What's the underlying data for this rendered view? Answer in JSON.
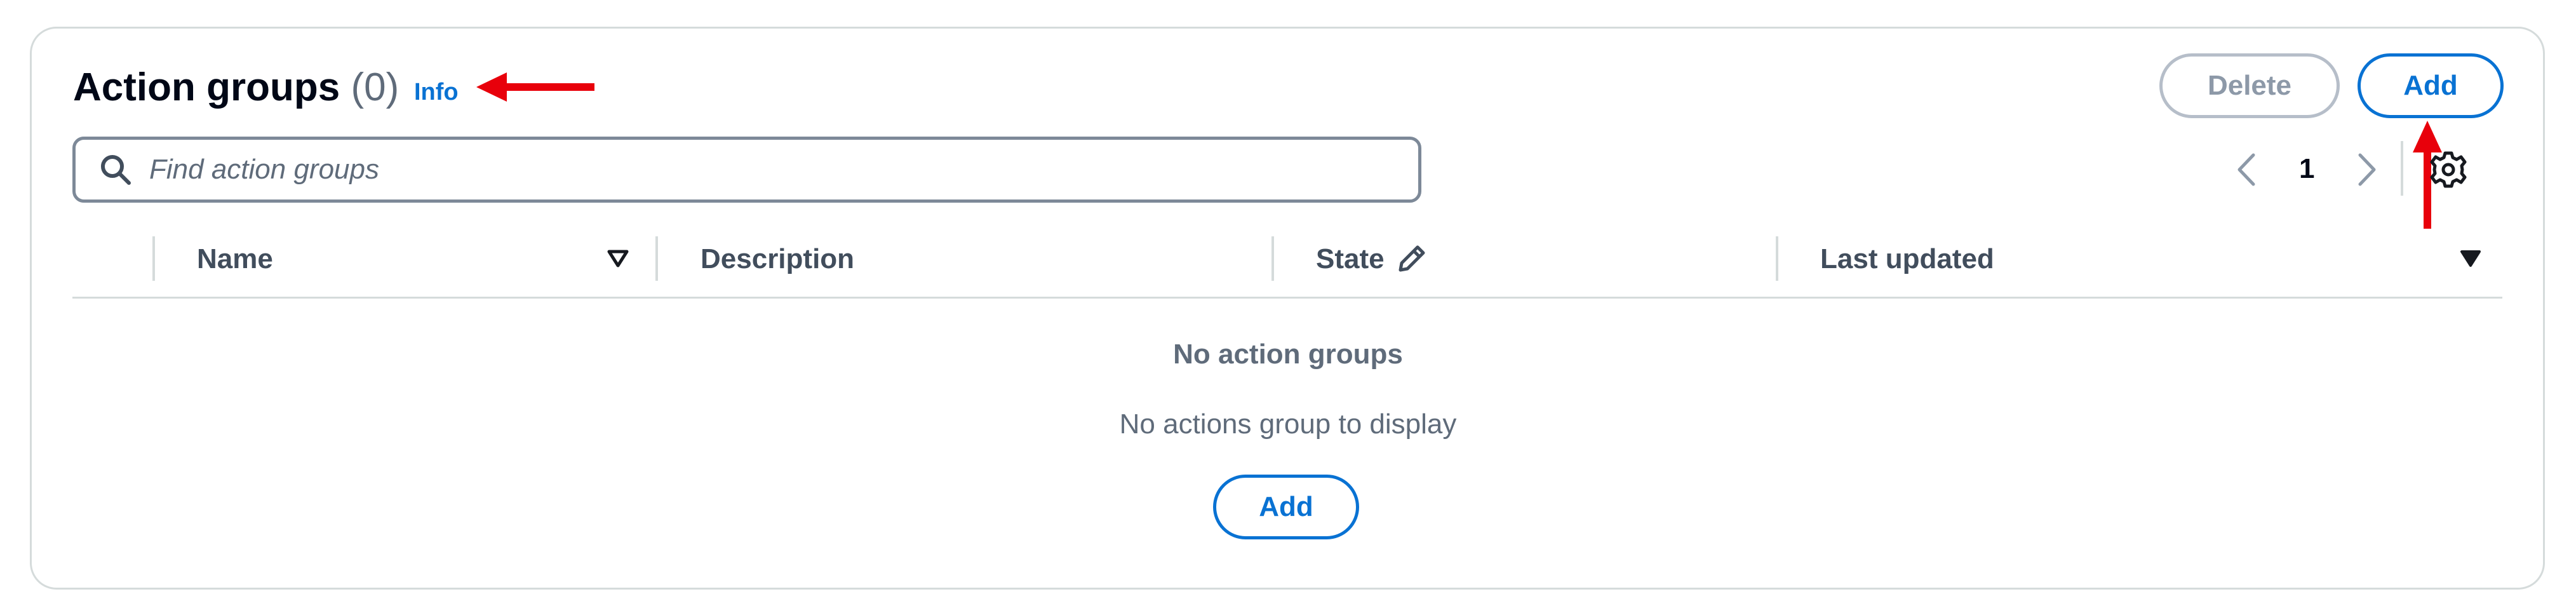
{
  "header": {
    "title": "Action groups",
    "count": "(0)",
    "info_label": "Info",
    "delete_label": "Delete",
    "add_label": "Add"
  },
  "search": {
    "placeholder": "Find action groups"
  },
  "pagination": {
    "current_page": "1"
  },
  "table": {
    "columns": [
      "Name",
      "Description",
      "State",
      "Last updated"
    ]
  },
  "empty_state": {
    "title": "No action groups",
    "description": "No actions group to display",
    "add_label": "Add"
  },
  "icons": {
    "search": "search-icon",
    "prev": "chevron-left-icon",
    "next": "chevron-right-icon",
    "settings": "gear-icon",
    "sort": "sort-down-icon",
    "edit": "pencil-icon"
  },
  "colors": {
    "accent": "#0972d3",
    "annotation": "#e8000b",
    "border": "#d5dbdb",
    "muted_text": "#5f6b7a"
  }
}
